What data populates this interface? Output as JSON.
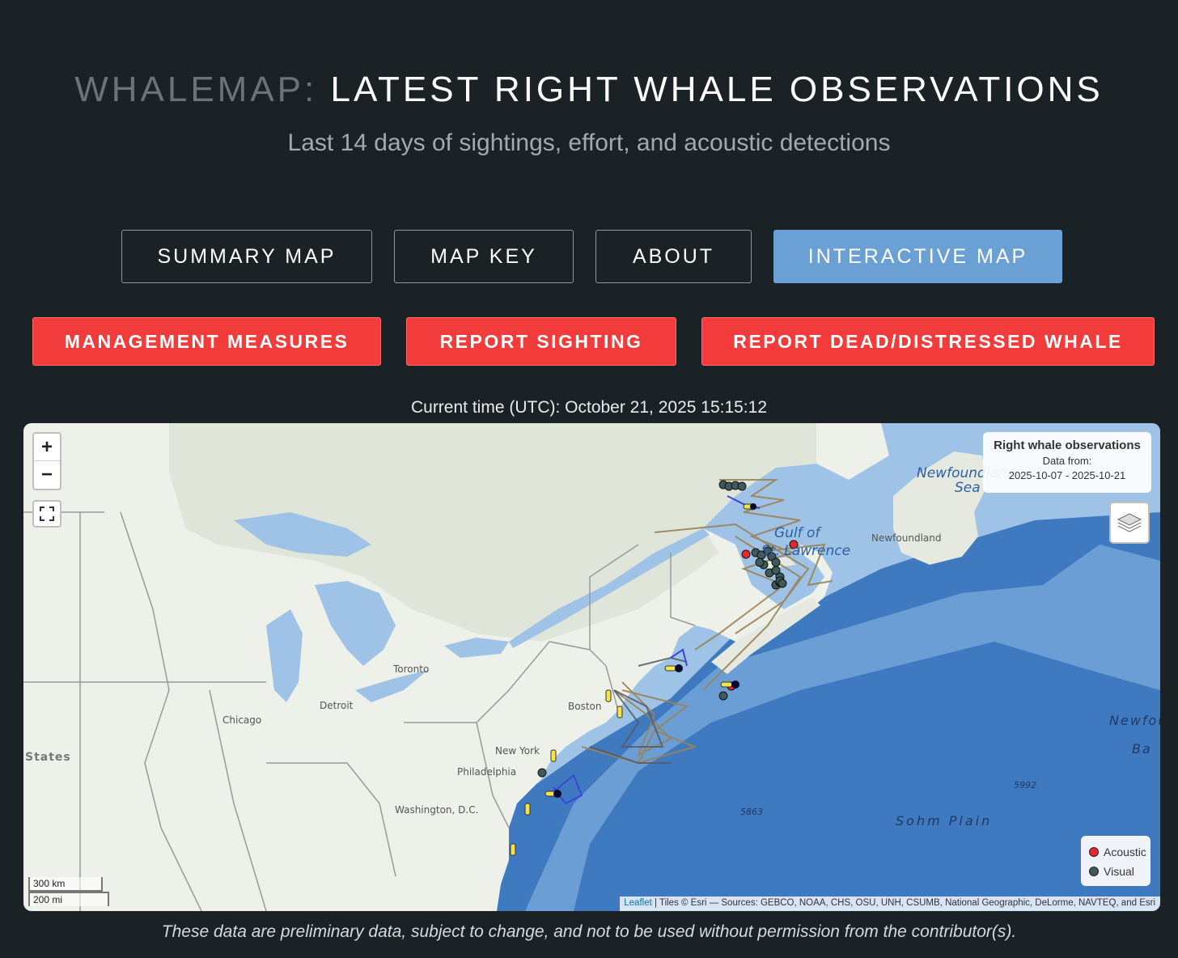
{
  "header": {
    "title_prefix": "WHALEMAP:",
    "title_main": "LATEST RIGHT WHALE OBSERVATIONS",
    "subtitle": "Last 14 days of sightings, effort, and acoustic detections"
  },
  "nav": {
    "summary_map": "SUMMARY MAP",
    "map_key": "MAP KEY",
    "about": "ABOUT",
    "interactive_map": "INTERACTIVE MAP"
  },
  "actions": {
    "management": "MANAGEMENT MEASURES",
    "report_sighting": "REPORT SIGHTING",
    "report_dead": "REPORT DEAD/DISTRESSED WHALE"
  },
  "time_label": "Current time (UTC): October 21, 2025 15:15:12",
  "map": {
    "zoom_in": "+",
    "zoom_out": "−",
    "legend_title": "Right whale observations",
    "legend_data_from": "Data from:",
    "legend_range": "2025-10-07 - 2025-10-21",
    "key_acoustic": "Acoustic",
    "key_visual": "Visual",
    "acoustic_color": "#e8262b",
    "visual_color": "#3f5a5a",
    "scale_km": "300 km",
    "scale_mi": "200 mi",
    "attribution_link": "Leaflet",
    "attribution_text": " | Tiles © Esri — Sources: GEBCO, NOAA, CHS, OSU, UNH, CSUMB, National Geographic, DeLorme, NAVTEQ, and Esri",
    "labels": {
      "newfoundland_sea": "Newfoundland",
      "sea": "Sea",
      "newfoundland": "Newfoundland",
      "gulf_of": "Gulf of",
      "lawrence": "St. Lawrence",
      "toronto": "Toronto",
      "detroit": "Detroit",
      "chicago": "Chicago",
      "boston": "Boston",
      "new_york": "New York",
      "philadelphia": "Philadelphia",
      "washington": "Washington, D.C.",
      "states": "States",
      "sohm_plain": "Sohm Plain",
      "newfou": "Newfou",
      "ba": "Ba",
      "depth_5863": "5863",
      "depth_5992": "5992"
    }
  },
  "disclaimer": "These data are preliminary data, subject to change, and not to be used without permission from the contributor(s)."
}
